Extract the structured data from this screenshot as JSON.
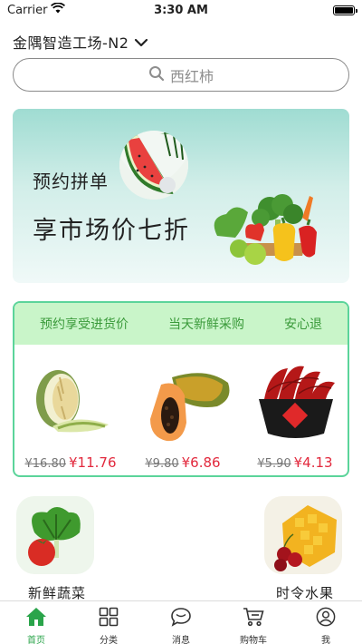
{
  "status_bar": {
    "carrier": "Carrier",
    "time": "3:30 AM"
  },
  "header": {
    "location": "金隅智造工场-N2"
  },
  "search": {
    "placeholder": "西红柿"
  },
  "banner": {
    "subtitle": "预约拼单",
    "title": "享市场价七折"
  },
  "deal": {
    "headers": [
      "预约享受进货价",
      "当天新鲜采购",
      "安心退"
    ],
    "items": [
      {
        "name": "melon",
        "old_price": "¥16.80",
        "new_price": "¥11.76"
      },
      {
        "name": "papaya",
        "old_price": "¥9.80",
        "new_price": "¥6.86"
      },
      {
        "name": "chili",
        "old_price": "¥5.90",
        "new_price": "¥4.13"
      }
    ]
  },
  "categories": [
    {
      "label": "新鲜蔬菜"
    },
    {
      "label": "时令水果"
    }
  ],
  "tabbar": {
    "active_color": "#2aa44a",
    "items": [
      {
        "label": "首页",
        "icon": "home-icon"
      },
      {
        "label": "分类",
        "icon": "grid-icon"
      },
      {
        "label": "消息",
        "icon": "message-icon"
      },
      {
        "label": "购物车",
        "icon": "cart-icon"
      },
      {
        "label": "我",
        "icon": "user-icon"
      }
    ]
  }
}
